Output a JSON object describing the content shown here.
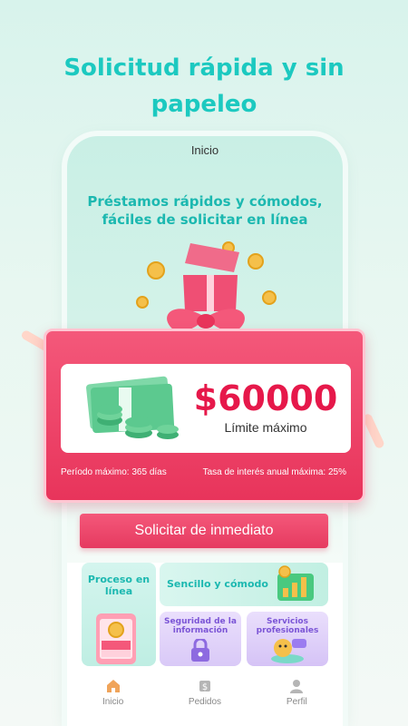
{
  "headline": {
    "line1": "Solicitud rápida y sin",
    "line2": "papeleo"
  },
  "screen": {
    "title": "Inicio",
    "promo_line1": "Préstamos rápidos y cómodos,",
    "promo_line2": "fáciles de solicitar en línea"
  },
  "loan_card": {
    "amount": "$60000",
    "amount_label": "Límite máximo",
    "term": "Período máximo: 365 días",
    "rate": "Tasa de interés anual máxima: 25%"
  },
  "apply_button": "Solicitar de inmediato",
  "features": {
    "online": "Proceso en línea",
    "simple": "Sencillo y cómodo",
    "security": "Seguridad de la información",
    "services": "Servicios profesionales"
  },
  "tabs": [
    {
      "label": "Inicio",
      "icon": "home-icon"
    },
    {
      "label": "Pedidos",
      "icon": "orders-icon"
    },
    {
      "label": "Perfil",
      "icon": "profile-icon"
    }
  ],
  "colors": {
    "teal": "#1cc9c0",
    "red": "#e6184a",
    "purple": "#7b55d6"
  }
}
